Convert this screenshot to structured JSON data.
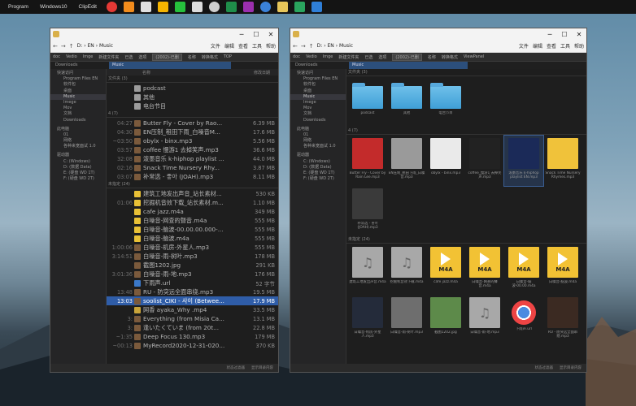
{
  "taskbar": {
    "items": [
      {
        "label": "Program"
      },
      {
        "label": "Windows10"
      },
      {
        "label": "ClipEdit"
      }
    ],
    "icons": [
      {
        "name": "record",
        "color": "#e53935"
      },
      {
        "name": "search",
        "color": "#f28c1c"
      },
      {
        "name": "image",
        "color": "#e0e0e0"
      },
      {
        "name": "star",
        "color": "#f5b400"
      },
      {
        "name": "wechat",
        "color": "#26c03c"
      },
      {
        "name": "chat",
        "color": "#dcdcdc"
      },
      {
        "name": "camera",
        "color": "#cfcfcf"
      },
      {
        "name": "excel",
        "color": "#1f8e4a"
      },
      {
        "name": "onenote",
        "color": "#9b2fae"
      },
      {
        "name": "chrome",
        "color": "#3b82d9"
      },
      {
        "name": "explorer",
        "color": "#e7c65a"
      },
      {
        "name": "app",
        "color": "#2aa55e"
      },
      {
        "name": "edge",
        "color": "#2f7fd8"
      }
    ]
  },
  "left": {
    "address": {
      "path": [
        "D:",
        "EN",
        "Music"
      ],
      "menu": [
        "文件",
        "编辑",
        "查看",
        "工具",
        "帮助"
      ]
    },
    "toolbar": [
      "doc",
      "Vedio",
      "Imge",
      "新建文件夹",
      "已选",
      "选项",
      "(2002)-已删",
      "名称",
      "转换格式",
      "TOP"
    ],
    "tab": "Music",
    "tabs_left": "Downloads",
    "tree": [
      {
        "label": "快速访问",
        "type": "top"
      },
      {
        "label": "Program Files EN",
        "type": "ind"
      },
      {
        "label": "软件包",
        "type": "ind"
      },
      {
        "label": "桌面",
        "type": "ind"
      },
      {
        "label": "Music",
        "type": "ind"
      },
      {
        "label": "Imege",
        "type": "ind"
      },
      {
        "label": "Mov",
        "type": "ind"
      },
      {
        "label": "文档",
        "type": "ind"
      },
      {
        "label": "Downloads",
        "type": "ind"
      },
      {
        "label": "",
        "type": "gap"
      },
      {
        "label": "此电脑",
        "type": "top"
      },
      {
        "label": "01",
        "type": "ind"
      },
      {
        "label": "网络",
        "type": "ind"
      },
      {
        "label": "各种来宽面试 1.0",
        "type": "ind"
      },
      {
        "label": "",
        "type": "gap"
      },
      {
        "label": "驱动器",
        "type": "top"
      },
      {
        "label": "C: (Windows)",
        "type": "ind"
      },
      {
        "label": "D: (数据 Data)",
        "type": "ind"
      },
      {
        "label": "E: (硬盘 WD 1T)",
        "type": "ind"
      },
      {
        "label": "F: (硬盘 WD 2T)",
        "type": "ind"
      }
    ],
    "colhead": {
      "name": "名称",
      "date": "修改日期"
    },
    "groups": {
      "folders": "文件夹 (3)",
      "four": "4 (7)",
      "unlabeled": "未指定 (24)"
    },
    "folders": [
      "podcast",
      "其他",
      "电台节目"
    ],
    "rows7": [
      {
        "t": "04:27",
        "n": "Butter Fly  - Cover by Rao...",
        "s": "6.39 MB",
        "ic": "img"
      },
      {
        "t": "04:30",
        "n": "EN压制_租田下雨_白噪音M...",
        "s": "17.6 MB",
        "ic": "img"
      },
      {
        "t": "~03:50",
        "n": "obylx - binx.mp3",
        "s": "5.56 MB",
        "ic": "img"
      },
      {
        "t": "03:57",
        "n": "coffee 慢游1 去掉笑声.mp3",
        "s": "36.6 MB",
        "ic": "img"
      },
      {
        "t": "32:08",
        "n": "泼墨音乐 k-hiphop playlist ...",
        "s": "44.0 MB",
        "ic": "img"
      },
      {
        "t": "02:16",
        "n": "Snack Time   Nursery Rhy...",
        "s": "3.87 MB",
        "ic": "img"
      },
      {
        "t": "03:07",
        "n": "补常选 - 좋아 (JOAH).mp3",
        "s": "8.11 MB",
        "ic": "img"
      }
    ],
    "rows24": [
      {
        "t": "",
        "n": "建筑工地发出声音_站长素材...",
        "s": "530 KB",
        "ic": "m4a"
      },
      {
        "t": "01:06",
        "n": "挖掘机音效下载_站长素材.m...",
        "s": "1.10 MB",
        "ic": "m4a"
      },
      {
        "t": "",
        "n": "cafe jazz.m4a",
        "s": "349 MB",
        "ic": "m4a"
      },
      {
        "t": "",
        "n": "白噪音-网查的聲音.m4a",
        "s": "555 MB",
        "ic": "m4a"
      },
      {
        "t": "",
        "n": "白噪音-脑波-00.00.00.000-...",
        "s": "555 MB",
        "ic": "m4a"
      },
      {
        "t": "",
        "n": "白噪音-脑波.m4a",
        "s": "555 MB",
        "ic": "m4a"
      },
      {
        "t": "1:00:06",
        "n": "白噪音-机房-外星人.mp3",
        "s": "555 MB",
        "ic": "img"
      },
      {
        "t": "3:14:51",
        "n": "白噪音-雨-树叶.mp3",
        "s": "178 MB",
        "ic": "img"
      },
      {
        "t": "",
        "n": "截图1202.jpg",
        "s": "291 KB",
        "ic": "img"
      },
      {
        "t": "3:01:36",
        "n": "白噪音-雨-地.mp3",
        "s": "176 MB",
        "ic": "img"
      },
      {
        "t": "",
        "n": "下雨声.url",
        "s": "52 字节",
        "ic": "url"
      },
      {
        "t": "13:48",
        "n": "RU - 防突远全面串绕.mp3",
        "s": "19.5 MB",
        "ic": "img"
      },
      {
        "t": "13:03",
        "n": "soolist_CIKI - 사이 (Betwee...",
        "s": "17.9 MB",
        "ic": "img",
        "sel": true
      },
      {
        "t": "",
        "n": "网香 ayaka_Why .mp4",
        "s": "33.5 MB",
        "ic": "mp4"
      },
      {
        "t": "3:",
        "n": "Everything   (from Misia Ca...",
        "s": "13.1 MB",
        "ic": "img"
      },
      {
        "t": "3:",
        "n": "逢いたくていま  (from 20t...",
        "s": "22.8 MB",
        "ic": "img"
      },
      {
        "t": "~1:35",
        "n": "Deep Focus 130.mp3",
        "s": "179 MB",
        "ic": "img"
      },
      {
        "t": "~00:13",
        "n": "MyRecord2020-12-31-020...",
        "s": "370 KB",
        "ic": "img"
      }
    ],
    "status": [
      "状态过滤器",
      "显示目录内容"
    ]
  },
  "right": {
    "address": {
      "path": [
        "D:",
        "EN",
        "Music"
      ],
      "menu": [
        "文件",
        "编辑",
        "查看",
        "工具",
        "帮助"
      ]
    },
    "toolbar": [
      "doc",
      "Vedio",
      "Imge",
      "新建文件夹",
      "已选",
      "选项",
      "(2002)-已删",
      "名称",
      "转换格式",
      "ViewPanel"
    ],
    "tab": "Music",
    "tabs_left": "Downloads",
    "groups": {
      "folders": "文件夹 (3)",
      "four": "4 (7)",
      "unlabeled": "未指定 (24)"
    },
    "folders": [
      "podcast",
      "其他",
      "电台节目"
    ],
    "grid7": [
      {
        "cap": "Butter Fly - Cover by Rain Lee.mp3",
        "kind": "img",
        "color": "#c32b2b"
      },
      {
        "cap": "EN压制_租田下雨_白噪音.mp3",
        "kind": "img",
        "color": "#9a9a9a"
      },
      {
        "cap": "obylx - binx.mp3",
        "kind": "img",
        "color": "#eaeaea"
      },
      {
        "cap": "coffee_慢游1 去掉笑声.mp3",
        "kind": "img",
        "color": "#222"
      },
      {
        "cap": "泼墨音乐 k-hiphop playlist EN.mp3",
        "kind": "img",
        "color": "#1b2a58",
        "sel": true
      },
      {
        "cap": "Snack Time Nursery Rhymes.mp3",
        "kind": "img",
        "color": "#f0c23a"
      },
      {
        "cap": "补常选 - 좋아 (JOAH).mp3",
        "kind": "img",
        "color": "#3a3a3a"
      }
    ],
    "grid24": [
      {
        "cap": "建筑工地发出声音.m4a",
        "kind": "note"
      },
      {
        "cap": "挖掘机音效下载.m4a",
        "kind": "note"
      },
      {
        "cap": "cafe jazz.m4a",
        "kind": "m4a"
      },
      {
        "cap": "白噪音-网查的聲音.m4a",
        "kind": "m4a"
      },
      {
        "cap": "白噪音-脑波-00.00.m4a",
        "kind": "m4a"
      },
      {
        "cap": "白噪音-脑波.m4a",
        "kind": "m4a"
      },
      {
        "cap": "白噪音-机房-外星人.mp3",
        "kind": "img",
        "color": "#242b3a"
      },
      {
        "cap": "白噪音-雨-树叶.mp3",
        "kind": "img",
        "color": "#6e6e6e"
      },
      {
        "cap": "截图1202.jpg",
        "kind": "img",
        "color": "#5d8a4a"
      },
      {
        "cap": "白噪音-雨-地.mp3",
        "kind": "note"
      },
      {
        "cap": "下雨声.url",
        "kind": "url"
      },
      {
        "cap": "RU - 防突远全面串绕.mp3",
        "kind": "img",
        "color": "#3b2a22"
      }
    ],
    "m4a_label": "M4A",
    "status": [
      "状态过滤器",
      "显示目录内容"
    ]
  },
  "window_controls": [
    "─",
    "☐",
    "✕"
  ]
}
